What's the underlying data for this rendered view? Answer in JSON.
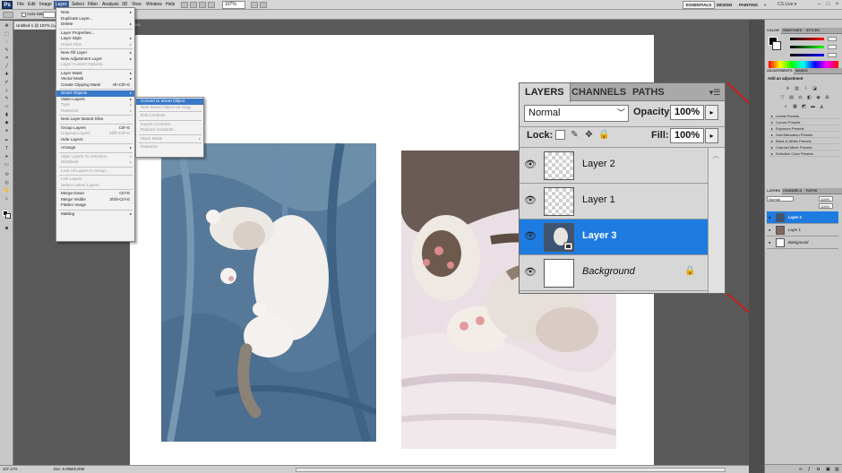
{
  "menubar": {
    "logo": "Ps",
    "items": [
      "File",
      "Edit",
      "Image",
      "Layer",
      "Select",
      "Filter",
      "Analysis",
      "3D",
      "View",
      "Window",
      "Help"
    ],
    "zoom": "107%"
  },
  "workspaces": [
    "ESSENTIALS",
    "DESIGN",
    "PAINTING",
    "»"
  ],
  "live": "CS Live ▾",
  "window_controls": [
    "–",
    "□",
    "×"
  ],
  "options_bar": {
    "auto_select": "Auto-Select:"
  },
  "document_tab": "Untitled-1 @ 107% (La",
  "document_tab2": "AMS DEMO.PSD",
  "layer_menu": [
    {
      "label": "New",
      "arrow": "▸"
    },
    {
      "label": "Duplicate Layer..."
    },
    {
      "label": "Delete",
      "arrow": "▸"
    },
    {
      "sep": true
    },
    {
      "label": "Layer Properties..."
    },
    {
      "label": "Layer Style",
      "arrow": "▸"
    },
    {
      "label": "Smart Filter",
      "arrow": "▸",
      "disabled": true
    },
    {
      "sep": true
    },
    {
      "label": "New Fill Layer",
      "arrow": "▸"
    },
    {
      "label": "New Adjustment Layer",
      "arrow": "▸"
    },
    {
      "label": "Layer Content Options...",
      "disabled": true
    },
    {
      "sep": true
    },
    {
      "label": "Layer Mask",
      "arrow": "▸"
    },
    {
      "label": "Vector Mask",
      "arrow": "▸"
    },
    {
      "label": "Create Clipping Mask",
      "shortcut": "Alt+Ctrl+G"
    },
    {
      "sep": true
    },
    {
      "label": "Smart Objects",
      "arrow": "▸",
      "highlight": true
    },
    {
      "label": "Video Layers",
      "arrow": "▸"
    },
    {
      "label": "Type",
      "arrow": "▸",
      "disabled": true
    },
    {
      "label": "Rasterize",
      "arrow": "▸",
      "disabled": true
    },
    {
      "sep": true
    },
    {
      "label": "New Layer Based Slice"
    },
    {
      "sep": true
    },
    {
      "label": "Group Layers",
      "shortcut": "Ctrl+G"
    },
    {
      "label": "Ungroup Layers",
      "shortcut": "Shift+Ctrl+G",
      "disabled": true
    },
    {
      "label": "Hide Layers"
    },
    {
      "sep": true
    },
    {
      "label": "Arrange",
      "arrow": "▸"
    },
    {
      "sep": true
    },
    {
      "label": "Align Layers To Selection",
      "arrow": "▸",
      "disabled": true
    },
    {
      "label": "Distribute",
      "arrow": "▸",
      "disabled": true
    },
    {
      "sep": true
    },
    {
      "label": "Lock All Layers in Group...",
      "disabled": true
    },
    {
      "sep": true
    },
    {
      "label": "Link Layers",
      "disabled": true
    },
    {
      "label": "Select Linked Layers",
      "disabled": true
    },
    {
      "sep": true
    },
    {
      "label": "Merge Down",
      "shortcut": "Ctrl+E"
    },
    {
      "label": "Merge Visible",
      "shortcut": "Shift+Ctrl+E"
    },
    {
      "label": "Flatten Image"
    },
    {
      "sep": true
    },
    {
      "label": "Matting",
      "arrow": "▸"
    }
  ],
  "smart_objects_submenu": [
    {
      "label": "Convert to Smart Object",
      "highlight": true
    },
    {
      "label": "New Smart Object via Copy",
      "disabled": true
    },
    {
      "sep": true
    },
    {
      "label": "Edit Contents",
      "disabled": true
    },
    {
      "sep": true
    },
    {
      "label": "Export Contents...",
      "disabled": true
    },
    {
      "label": "Replace Contents...",
      "disabled": true
    },
    {
      "sep": true
    },
    {
      "label": "Stack Mode",
      "arrow": "▸",
      "disabled": true
    },
    {
      "sep": true
    },
    {
      "label": "Rasterize",
      "disabled": true
    }
  ],
  "layers_panel": {
    "tabs": [
      "LAYERS",
      "CHANNELS",
      "PATHS"
    ],
    "menu_icon": "▾☰",
    "blend_mode": "Normal",
    "opacity_label": "Opacity:",
    "opacity": "100%",
    "lock_label": "Lock:",
    "fill_label": "Fill:",
    "fill": "100%",
    "stepper": "▸",
    "layers": [
      {
        "name": "Layer 2",
        "thumb": "transparent",
        "selected": false
      },
      {
        "name": "Layer 1",
        "thumb": "transparent",
        "selected": false
      },
      {
        "name": "Layer 3",
        "thumb": "photo",
        "selected": true
      },
      {
        "name": "Background",
        "thumb": "white",
        "selected": false,
        "italic": true,
        "locked": true
      }
    ]
  },
  "dock": {
    "color_tabs": [
      "COLOR",
      "SWATCHES",
      "STYLES"
    ],
    "adj_tabs": [
      "ADJUSTMENTS",
      "MASKS"
    ],
    "adj_title": "Add an adjustment",
    "presets": [
      "Levels Presets",
      "Curves Presets",
      "Exposure Presets",
      "Hue/Saturation Presets",
      "Black & White Presets",
      "Channel Mixer Presets",
      "Selective Color Presets"
    ],
    "layer_tabs": [
      "LAYERS",
      "CHANNELS",
      "PATHS"
    ],
    "blend_mode": "Normal",
    "opacity": "100%",
    "fill": "100%",
    "layers": [
      "Layer 3",
      "Layer 1",
      "Background"
    ]
  },
  "statusbar": {
    "zoom": "107.17%",
    "doc": "Doc: 6.89M/5.00M"
  },
  "colors": {
    "highlight": "#3a78c8",
    "selected_layer": "#1e7be0",
    "callout_line": "#e01010"
  }
}
